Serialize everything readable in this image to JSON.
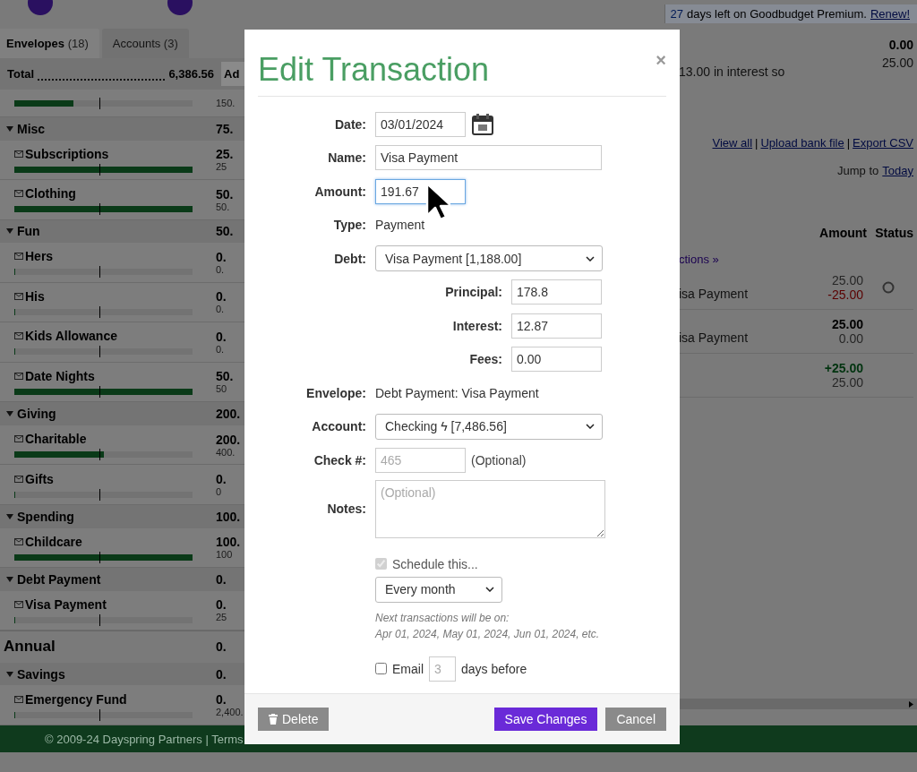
{
  "banner": {
    "days": "27",
    "text": "days left on Goodbudget Premium.",
    "link": "Renew!"
  },
  "sidebar": {
    "tabs": [
      {
        "label": "Envelopes",
        "count": "(18)",
        "selected": true
      },
      {
        "label": "Accounts",
        "count": "(3)",
        "selected": false
      }
    ],
    "total": {
      "label": "Total",
      "amount": "6,386.56",
      "button": "Ad"
    },
    "rows": [
      {
        "kind": "envelope",
        "budget": "150.",
        "level": 0.33
      },
      {
        "kind": "group",
        "name": "Misc",
        "amount": "75."
      },
      {
        "kind": "envelope",
        "name": "Subscriptions",
        "amount": "25.",
        "budget": "25",
        "level": 1
      },
      {
        "kind": "envelope",
        "name": "Clothing",
        "amount": "50.",
        "budget": "50.",
        "level": 1
      },
      {
        "kind": "group",
        "name": "Fun",
        "amount": "50."
      },
      {
        "kind": "envelope",
        "name": "Hers",
        "amount": "0.",
        "budget": "0.",
        "level": 0
      },
      {
        "kind": "envelope",
        "name": "His",
        "amount": "0.",
        "budget": "0.",
        "level": 0
      },
      {
        "kind": "envelope",
        "name": "Kids Allowance",
        "amount": "0.",
        "budget": "0.",
        "level": 0
      },
      {
        "kind": "envelope",
        "name": "Date Nights",
        "amount": "50.",
        "budget": "50",
        "level": 1
      },
      {
        "kind": "group",
        "name": "Giving",
        "amount": "200."
      },
      {
        "kind": "envelope",
        "name": "Charitable",
        "amount": "200.",
        "budget": "400.",
        "level": 0.5
      },
      {
        "kind": "envelope",
        "name": "Gifts",
        "amount": "0.",
        "budget": "0",
        "level": 0
      },
      {
        "kind": "group",
        "name": "Spending",
        "amount": "100."
      },
      {
        "kind": "envelope",
        "name": "Childcare",
        "amount": "100.",
        "budget": "100",
        "level": 1
      },
      {
        "kind": "group",
        "name": "Debt Payment",
        "amount": "0."
      },
      {
        "kind": "envelope",
        "name": "Visa Payment",
        "amount": "0.",
        "budget": "25",
        "level": 0
      },
      {
        "kind": "section",
        "name": "Annual",
        "amount": "0."
      },
      {
        "kind": "group",
        "name": "Savings",
        "amount": "0."
      },
      {
        "kind": "envelope",
        "name": "Emergency Fund",
        "amount": "0.",
        "budget": "2,400.",
        "level": 0
      }
    ]
  },
  "summary": {
    "balance": "0.00",
    "sub": "25.00",
    "note": "13.00 in interest so"
  },
  "links": [
    "View all",
    "Upload bank file",
    "Export CSV"
  ],
  "link_separator": "|",
  "jump": {
    "label": "Jump to",
    "link": "Today"
  },
  "table": {
    "columns": [
      "Amount",
      "Status"
    ],
    "more_link": "ctions »",
    "rows": [
      {
        "payee": "isa Payment",
        "amount": {
          "text": "25.00",
          "color": "#262626",
          "bold": false
        },
        "balance": {
          "text": "-25.00",
          "color": "#5a0000",
          "bold": false
        },
        "status_mark": true
      },
      {
        "payee": "isa Payment",
        "amount": {
          "text": "25.00",
          "color": "#000000",
          "bold": true
        },
        "balance": {
          "text": "0.00",
          "color": "#262626",
          "bold": false
        },
        "status_mark": false
      },
      {
        "payee": "",
        "amount": {
          "text": "+25.00",
          "color": "#00330f",
          "bold": true
        },
        "balance": {
          "text": "25.00",
          "color": "#262626",
          "bold": false
        },
        "status_mark": false
      }
    ]
  },
  "footer": "© 2009-24 Dayspring Partners | Terms",
  "modal": {
    "title": "Edit Transaction",
    "close": "×",
    "fields": [
      {
        "kind": "date",
        "label": "Date:",
        "value": "03/01/2024",
        "focused": false
      },
      {
        "kind": "text",
        "label": "Name:",
        "value": "Visa Payment",
        "focused": false
      },
      {
        "kind": "amount",
        "label": "Amount:",
        "value": "191.67",
        "focused": true
      },
      {
        "kind": "static",
        "label": "Type:",
        "value": "Payment"
      },
      {
        "kind": "select",
        "label": "Debt:",
        "value": "Visa Payment [1,188.00]"
      },
      {
        "kind": "split",
        "label": "Principal:",
        "value": "178.8",
        "focused": false
      },
      {
        "kind": "split",
        "label": "Interest:",
        "value": "12.87",
        "focused": false
      },
      {
        "kind": "split",
        "label": "Fees:",
        "value": "0.00",
        "focused": false
      },
      {
        "kind": "static",
        "label": "Envelope:",
        "value": "Debt Payment: Visa Payment"
      },
      {
        "kind": "select",
        "label": "Account:",
        "value": "Checking ϟ [7,486.56]"
      },
      {
        "kind": "check",
        "label": "Check #:",
        "placeholder": "465",
        "hint": "(Optional)"
      },
      {
        "kind": "notes",
        "label": "Notes:",
        "placeholder": "(Optional)"
      }
    ],
    "schedule": {
      "label": "Schedule this...",
      "checked": true,
      "disabled": true,
      "frequency": "Every month",
      "note_title": "Next transactions will be on:",
      "note_dates": "Apr 01, 2024, May 01, 2024, Jun 01, 2024, etc."
    },
    "email": {
      "label": "Email",
      "checked": false,
      "placeholder": "3",
      "suffix": "days before"
    },
    "buttons": [
      {
        "kind": "delete",
        "label": "Delete"
      },
      {
        "kind": "primary",
        "label": "Save Changes"
      },
      {
        "kind": "secondary",
        "label": "Cancel"
      }
    ]
  }
}
